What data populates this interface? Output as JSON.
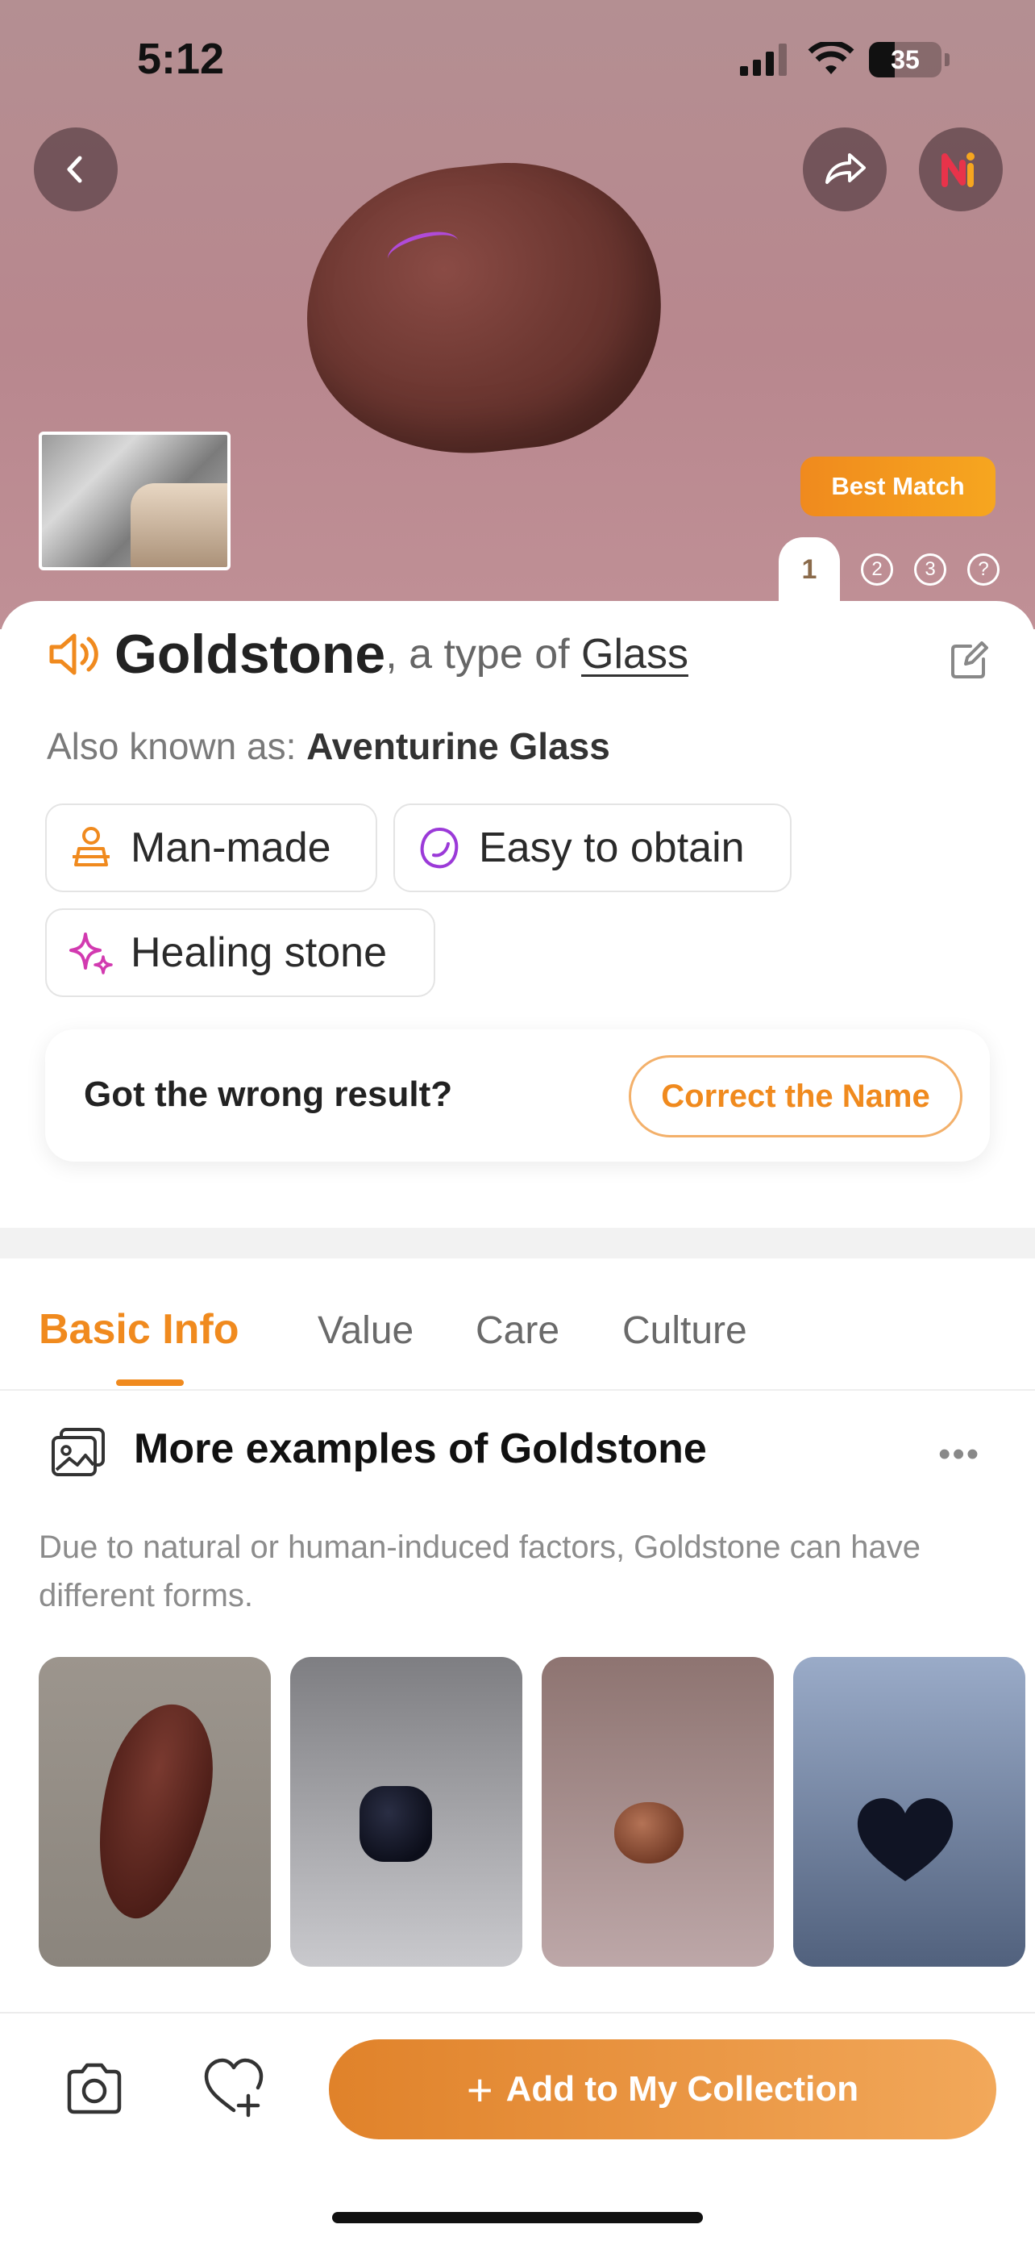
{
  "status_bar": {
    "time": "5:12",
    "battery": "35"
  },
  "hero": {
    "badge": "Best Match",
    "pages": [
      "1",
      "2",
      "3",
      "?"
    ]
  },
  "result": {
    "name": "Goldstone",
    "type_prefix": ", a type of ",
    "type": "Glass",
    "aka_label": "Also known as:",
    "aka_value": "Aventurine Glass",
    "tags": [
      {
        "label": "Man-made",
        "icon": "person-icon",
        "color": "#f08a1e"
      },
      {
        "label": "Easy to obtain",
        "icon": "gem-icon",
        "color": "#9b3ad8"
      },
      {
        "label": "Healing stone",
        "icon": "sparkle-icon",
        "color": "#d23ab0"
      }
    ]
  },
  "feedback": {
    "question": "Got the wrong result?",
    "button": "Correct the Name"
  },
  "tabs": [
    "Basic Info",
    "Value",
    "Care",
    "Culture"
  ],
  "examples": {
    "title": "More examples of Goldstone",
    "description": "Due to natural or human-induced factors, Goldstone can have different forms."
  },
  "bottom_bar": {
    "add_label": "Add to My Collection"
  },
  "colors": {
    "accent": "#f08a1e",
    "brand_gradient": [
      "#e0822a",
      "#f2a85a"
    ]
  }
}
